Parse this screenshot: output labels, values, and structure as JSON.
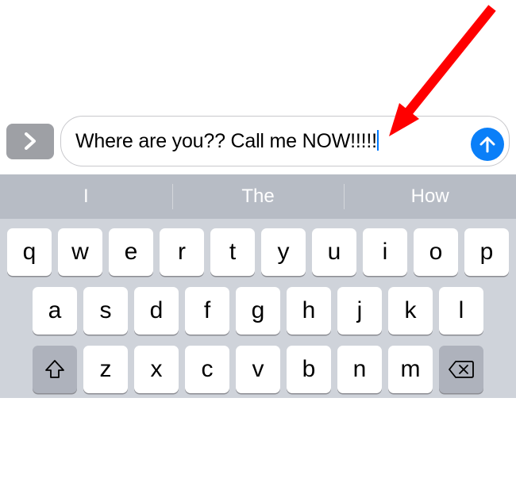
{
  "compose": {
    "message_text": "Where are you?? Call me NOW!!!!!",
    "expand_label": "Expand",
    "send_label": "Send"
  },
  "suggestions": [
    "I",
    "The",
    "How"
  ],
  "keyboard": {
    "row1": [
      "q",
      "w",
      "e",
      "r",
      "t",
      "y",
      "u",
      "i",
      "o",
      "p"
    ],
    "row2": [
      "a",
      "s",
      "d",
      "f",
      "g",
      "h",
      "j",
      "k",
      "l"
    ],
    "row3": [
      "z",
      "x",
      "c",
      "v",
      "b",
      "n",
      "m"
    ],
    "shift_label": "Shift",
    "backspace_label": "Backspace"
  },
  "colors": {
    "send_bg": "#0a7ff8",
    "key_bg": "#ffffff",
    "special_key_bg": "#aeb2bc",
    "keyboard_bg": "#cfd3da",
    "suggestion_bg": "#b7bcc5"
  },
  "annotation": {
    "arrow_points_to": "send-button"
  }
}
